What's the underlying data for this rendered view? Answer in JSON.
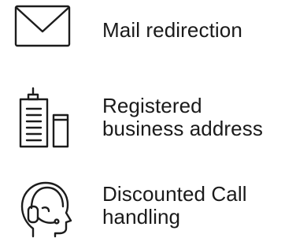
{
  "features": [
    {
      "icon": "envelope-icon",
      "label": "Mail redirection"
    },
    {
      "icon": "buildings-icon",
      "label_line1": "Registered",
      "label_line2": "business address"
    },
    {
      "icon": "headset-icon",
      "label_line1": "Discounted Call",
      "label_line2": "handling"
    }
  ],
  "colors": {
    "text": "#1a1a1a",
    "icon_stroke": "#1c1c1c",
    "background": "#ffffff"
  }
}
